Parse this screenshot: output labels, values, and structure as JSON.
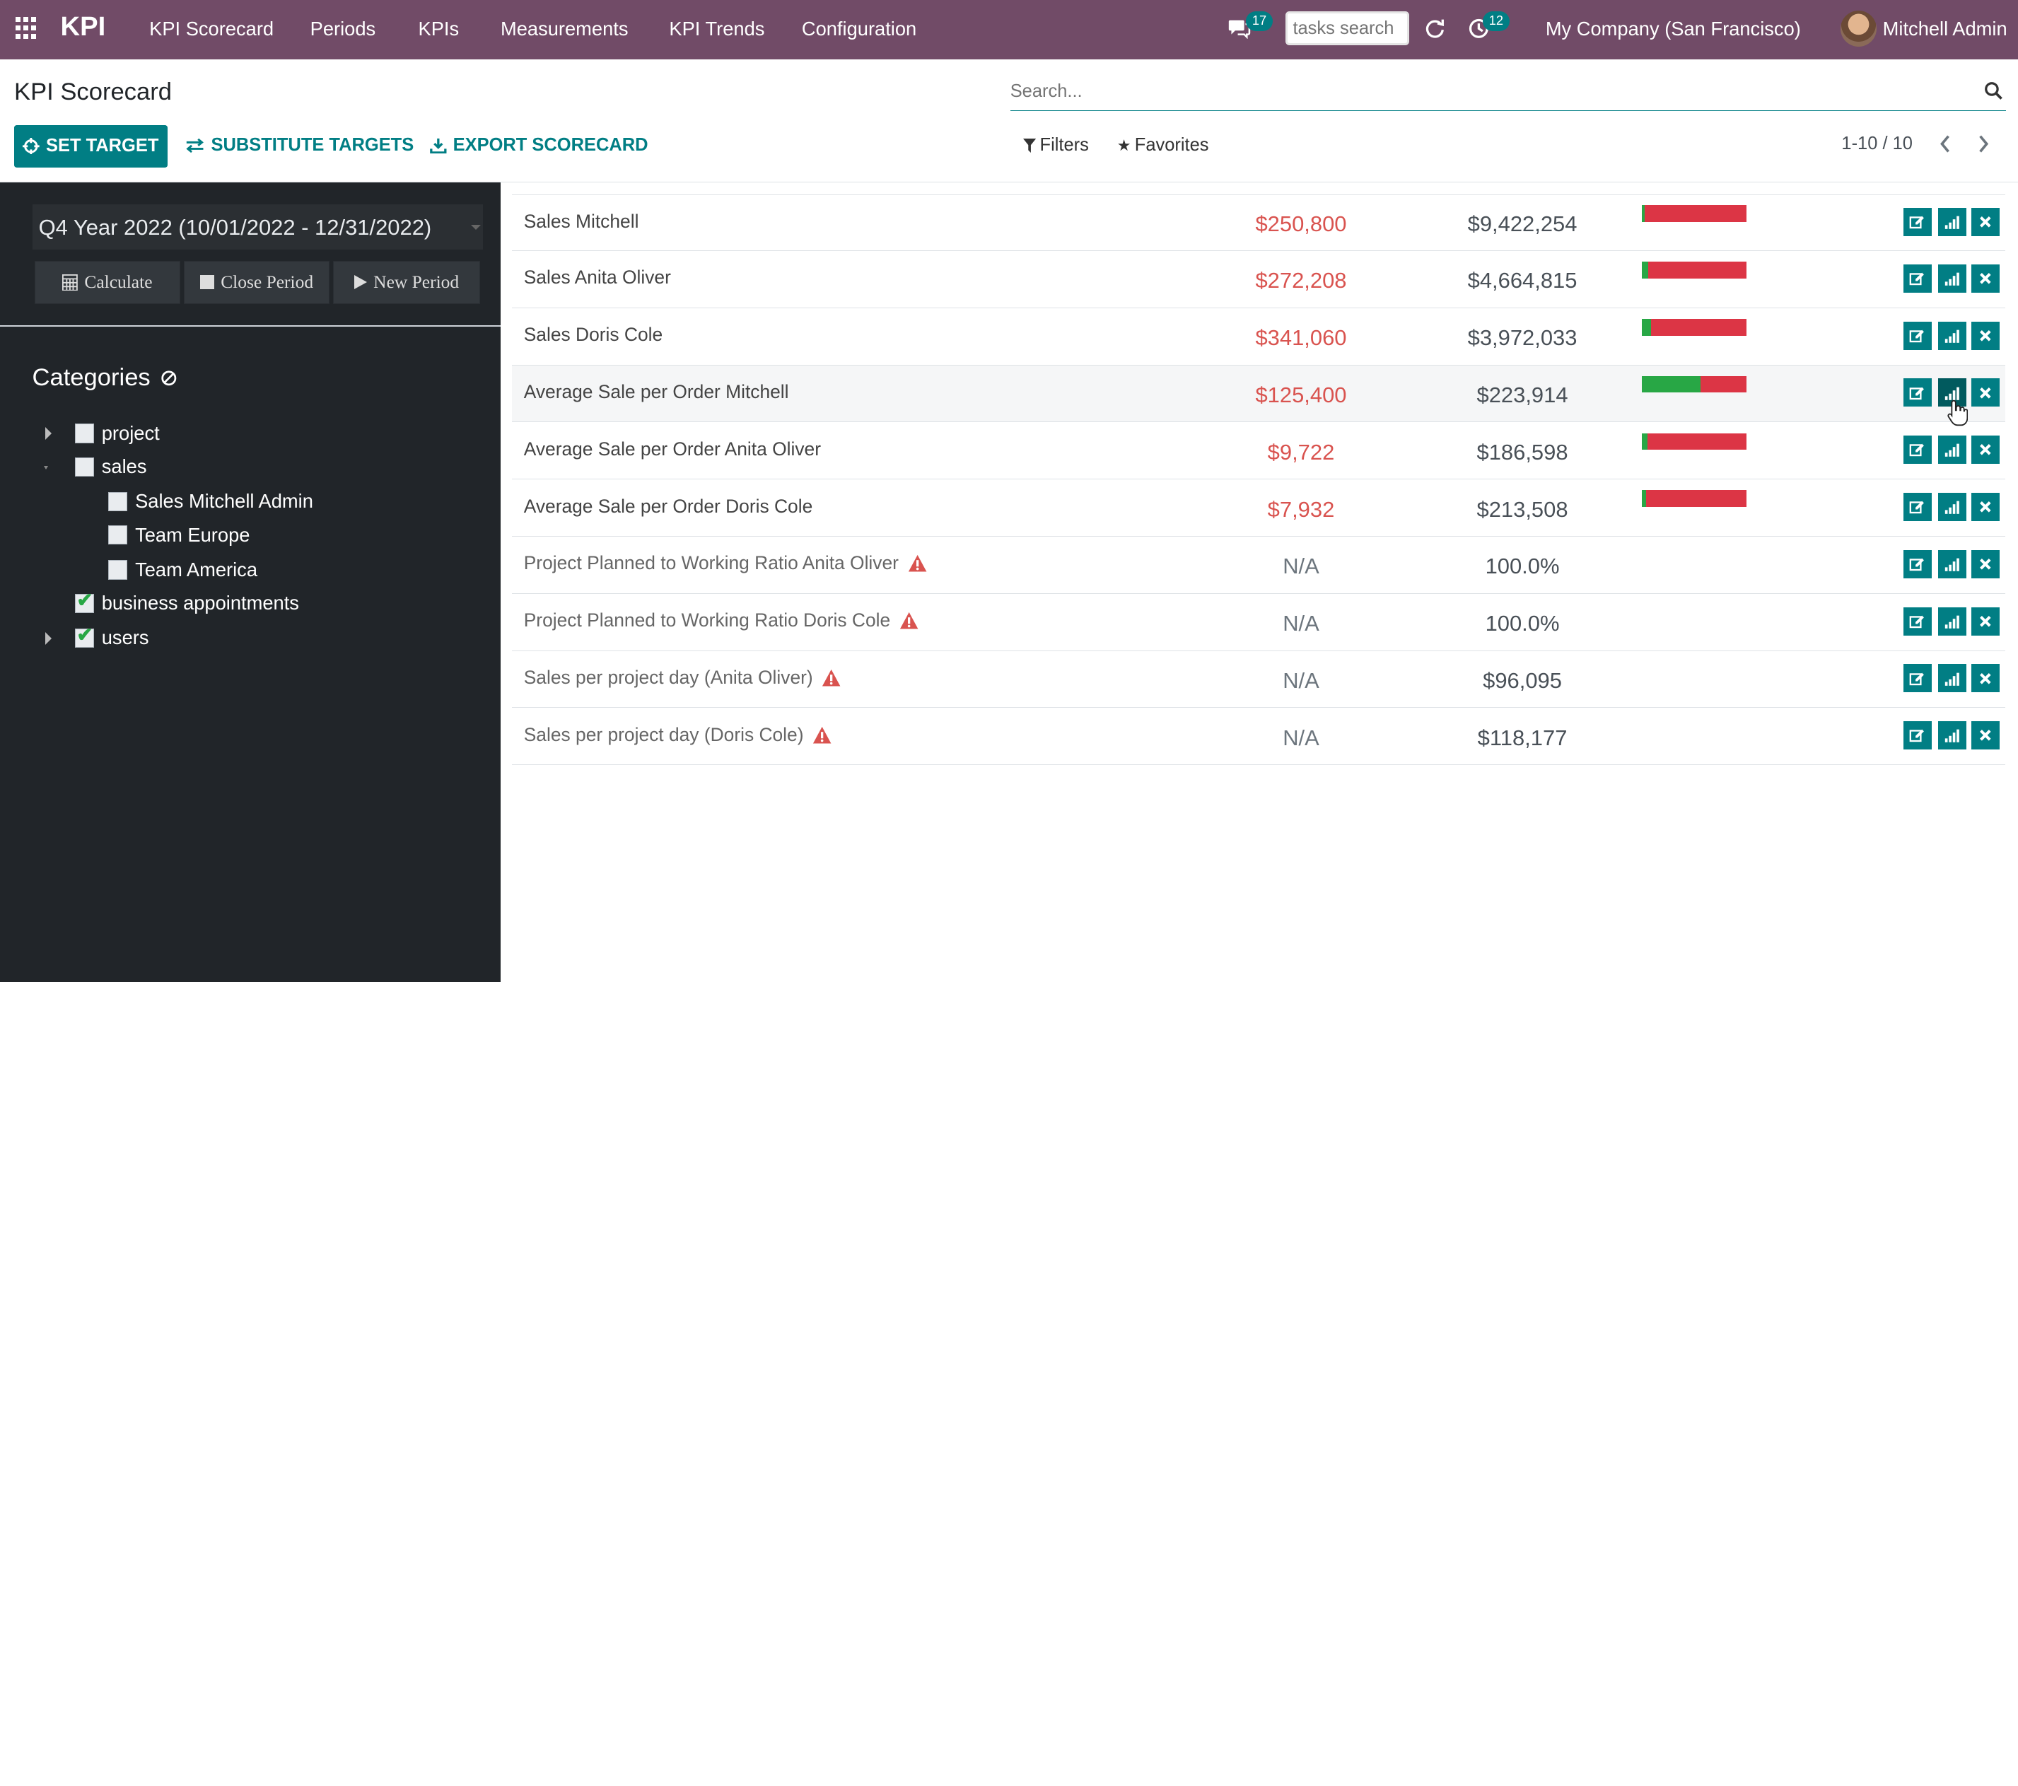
{
  "navbar": {
    "brand": "KPI",
    "menu": [
      "KPI Scorecard",
      "Periods",
      "KPIs",
      "Measurements",
      "KPI Trends",
      "Configuration"
    ],
    "messages_count": "17",
    "tasks_search_placeholder": "tasks search",
    "activities_count": "12",
    "company": "My Company (San Francisco)",
    "user": "Mitchell Admin",
    "color": "#714B67"
  },
  "control_panel": {
    "title": "KPI Scorecard",
    "search_placeholder": "Search...",
    "set_target": "SET TARGET",
    "substitute_targets": "SUBSTITUTE TARGETS",
    "export_scorecard": "EXPORT SCORECARD",
    "filters": "Filters",
    "favorites": "Favorites",
    "pager": "1-10 / 10",
    "accent": "#017e84"
  },
  "sidebar": {
    "period": "Q4 Year 2022 (10/01/2022 - 12/31/2022)",
    "buttons": {
      "calculate": "Calculate",
      "close_period": "Close Period",
      "new_period": "New Period"
    },
    "categories_title": "Categories",
    "tree": [
      {
        "label": "project",
        "checked": false
      },
      {
        "label": "sales",
        "checked": false
      },
      {
        "label": "Sales Mitchell Admin",
        "checked": false
      },
      {
        "label": "Team Europe",
        "checked": false
      },
      {
        "label": "Team America",
        "checked": false
      },
      {
        "label": "business appointments",
        "checked": true
      },
      {
        "label": "users",
        "checked": true
      }
    ]
  },
  "rows": [
    {
      "name": "Sales Mitchell",
      "actual": "$250,800",
      "target": "$9,422,254",
      "progress": 0.027,
      "warning": false
    },
    {
      "name": "Sales Anita Oliver",
      "actual": "$272,208",
      "target": "$4,664,815",
      "progress": 0.058,
      "warning": false
    },
    {
      "name": "Sales Doris Cole",
      "actual": "$341,060",
      "target": "$3,972,033",
      "progress": 0.086,
      "warning": false
    },
    {
      "name": "Average Sale per Order Mitchell",
      "actual": "$125,400",
      "target": "$223,914",
      "progress": 0.56,
      "warning": false
    },
    {
      "name": "Average Sale per Order Anita Oliver",
      "actual": "$9,722",
      "target": "$186,598",
      "progress": 0.052,
      "warning": false
    },
    {
      "name": "Average Sale per Order Doris Cole",
      "actual": "$7,932",
      "target": "$213,508",
      "progress": 0.037,
      "warning": false
    },
    {
      "name": "Project Planned to Working Ratio Anita Oliver",
      "actual": "N/A",
      "target": "100.0%",
      "progress": null,
      "warning": true
    },
    {
      "name": "Project Planned to Working Ratio Doris Cole",
      "actual": "N/A",
      "target": "100.0%",
      "progress": null,
      "warning": true
    },
    {
      "name": "Sales per project day (Anita Oliver)",
      "actual": "N/A",
      "target": "$96,095",
      "progress": null,
      "warning": true
    },
    {
      "name": "Sales per project day (Doris Cole)",
      "actual": "N/A",
      "target": "$118,177",
      "progress": null,
      "warning": true
    }
  ],
  "colors": {
    "negative": "#d9534f",
    "progress_good": "#28a745",
    "progress_bad": "#dc3545",
    "sidebar_bg": "#212529"
  }
}
